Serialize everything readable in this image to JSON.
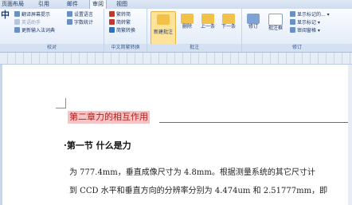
{
  "tabs": [
    "页面布局",
    "引用",
    "邮件",
    "审阅",
    "视图"
  ],
  "ribbon": {
    "proof": {
      "items": [
        "翻译屏幕提示",
        "英语助手",
        "更新输入法词典",
        "设置语言",
        "字数统计"
      ],
      "label": "校对"
    },
    "chinese": {
      "items": [
        "繁转简",
        "简转繁",
        "简繁转换"
      ],
      "label": "中文简繁转换"
    },
    "comments": {
      "new": "新建批注",
      "delete": "删除",
      "prev": "上一条",
      "next": "下一条",
      "label": "批注"
    },
    "tracking": {
      "track": "修订",
      "balloons": "批注框",
      "markup": "显示标记的...",
      "show": "显示标记",
      "pane": "审阅窗格",
      "label": "修订"
    }
  },
  "document": {
    "heading": "第二章力的相互作用",
    "subheading": "·第一节 什么是力",
    "line1": "为 777.4mm，垂直成像尺寸为 4.8mm。根据测量系统的其它尺寸计",
    "line2": "到 CCD 水平和垂直方向的分辨率分别为 4.474um 和 2.51777mm，即"
  }
}
